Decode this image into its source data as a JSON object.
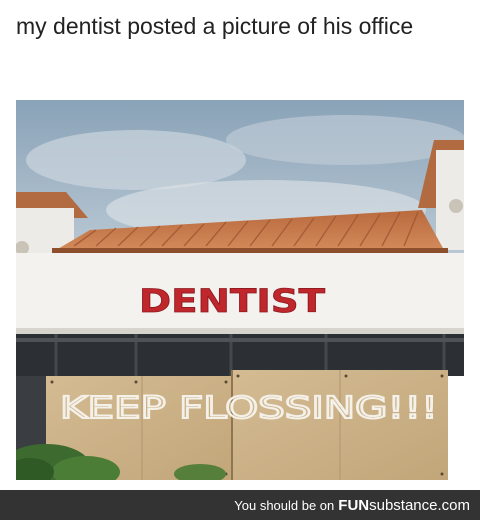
{
  "post": {
    "caption": "my dentist posted a picture of his office"
  },
  "photo": {
    "sign_text": "DENTIST",
    "board_text": "KEEP FLOSSING!!!",
    "colors": {
      "sky": "#9fb4c6",
      "roof": "#c97c4f",
      "sign": "#c0272d",
      "wall": "#f2f1ee",
      "plywood": "#cdb38a"
    }
  },
  "footer": {
    "tagline": "You should be on",
    "brand_bold": "FUN",
    "brand_rest": "substance.com",
    "background": "#333333"
  }
}
